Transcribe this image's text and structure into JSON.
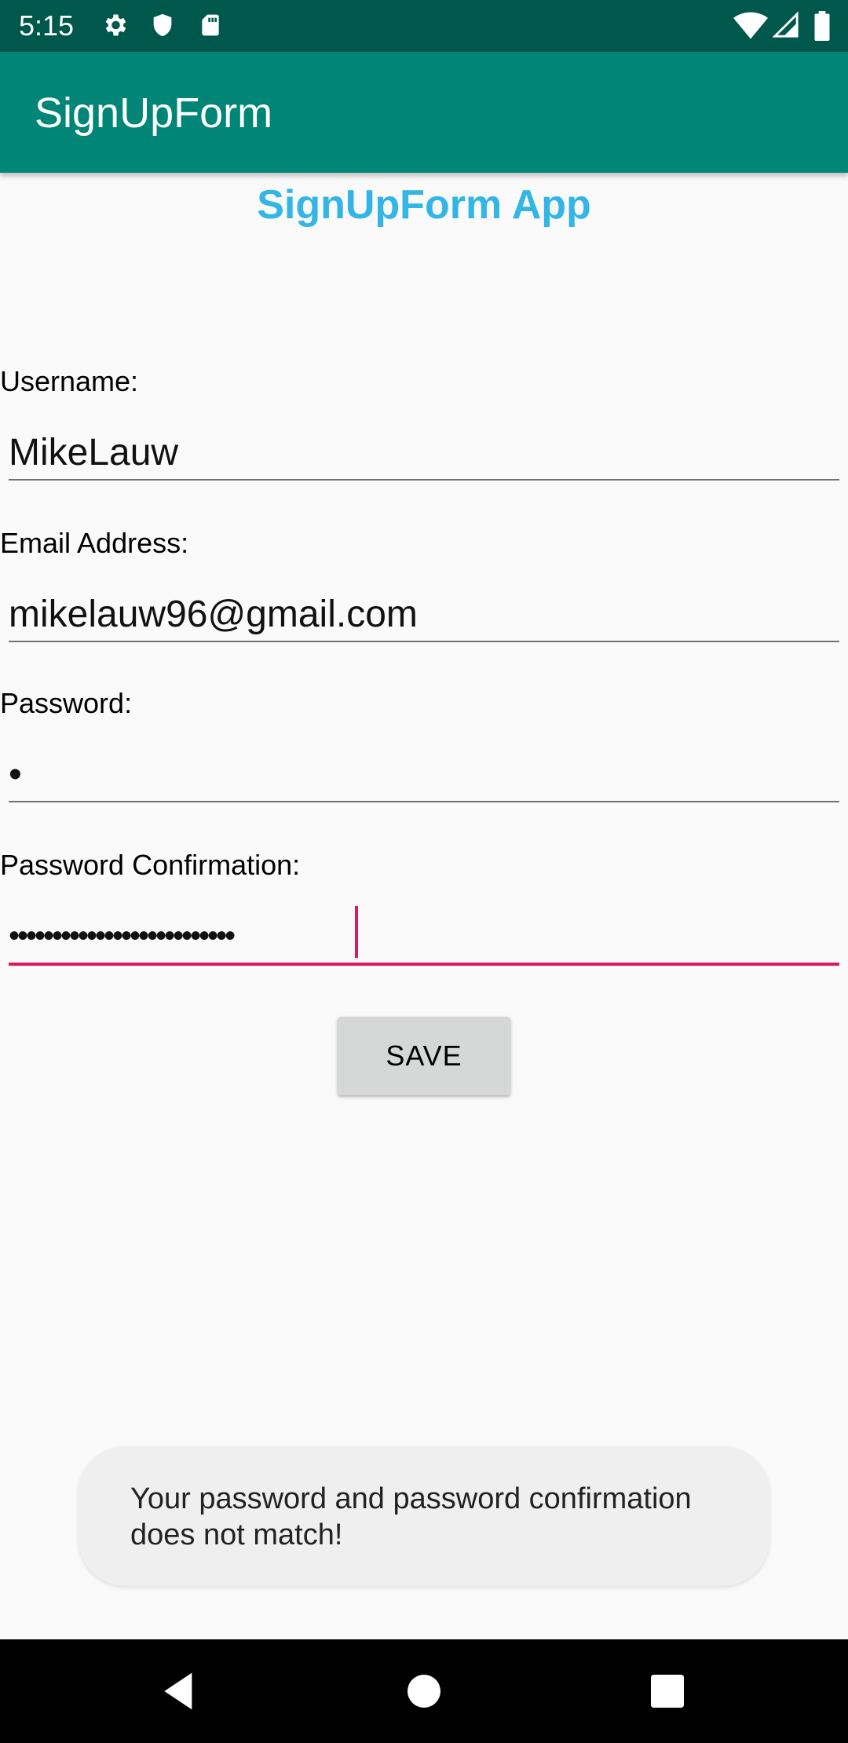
{
  "status_bar": {
    "time": "5:15",
    "icons_left": [
      "gear-icon",
      "shield-icon",
      "sd-card-icon"
    ],
    "icons_right": [
      "wifi-icon",
      "signal-icon",
      "battery-icon"
    ]
  },
  "app_bar": {
    "title": "SignUpForm"
  },
  "heading": "SignUpForm App",
  "form": {
    "username_label": "Username:",
    "username_value": "MikeLauw",
    "email_label": "Email Address:",
    "email_value": "mikelauw96@gmail.com",
    "password_label": "Password:",
    "password_value": "•",
    "confirm_label": "Password Confirmation:",
    "confirm_value": "••••••••••••••••••••••••••"
  },
  "save_button": "SAVE",
  "toast": "Your password and password confirmation does not match!",
  "nav_bar": {
    "buttons": [
      "back-icon",
      "home-icon",
      "recents-icon"
    ]
  },
  "colors": {
    "status_bar": "#00574b",
    "app_bar": "#008577",
    "heading": "#33b5e5",
    "focus_accent": "#d81b60"
  }
}
